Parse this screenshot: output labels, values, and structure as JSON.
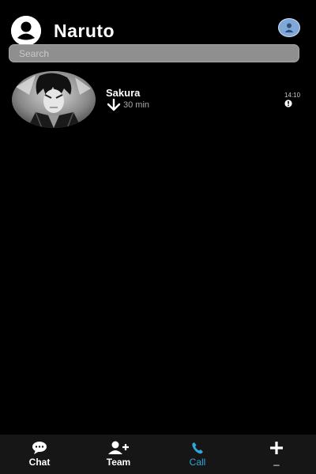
{
  "header": {
    "title": "Naruto",
    "left_icon": "user-circle-icon",
    "right_icon": "profile-icon"
  },
  "search": {
    "placeholder": "Search",
    "value": ""
  },
  "calls": [
    {
      "name": "Sakura",
      "direction_icon": "incoming-arrow-icon",
      "duration": "30 min",
      "time": "14:10",
      "info_icon": "info-icon"
    }
  ],
  "bottom_nav": {
    "items": [
      {
        "label": "Chat",
        "icon": "chat-bubble-icon",
        "active": false
      },
      {
        "label": "Team",
        "icon": "add-user-icon",
        "active": false
      },
      {
        "label": "Call",
        "icon": "phone-icon",
        "active": true
      },
      {
        "label": "_",
        "icon": "plus-icon",
        "active": false
      }
    ]
  },
  "colors": {
    "background": "#000000",
    "accent": "#2ea8dd",
    "search_bg": "#8f8f8f",
    "nav_bg": "#161616"
  }
}
